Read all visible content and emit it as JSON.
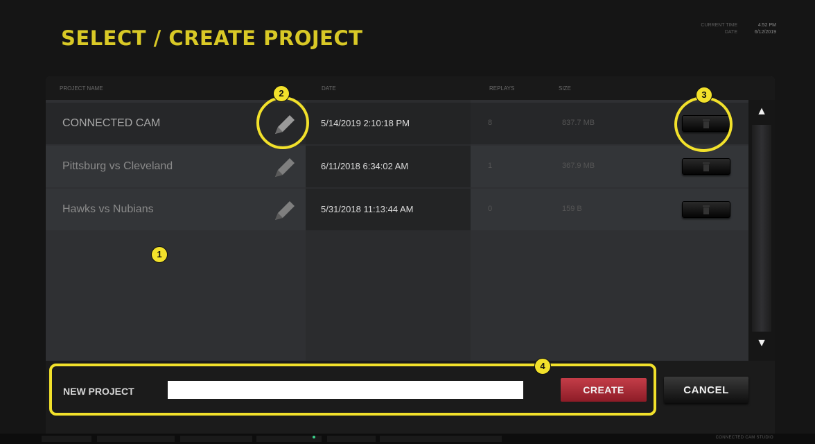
{
  "header": {
    "title": "SELECT / CREATE PROJECT",
    "clock": {
      "time_label": "CURRENT TIME",
      "date_label": "DATE",
      "time_value": "4:52 PM",
      "date_value": "6/12/2019"
    }
  },
  "table": {
    "columns": [
      "PROJECT NAME",
      "DATE",
      "REPLAYS",
      "SIZE"
    ],
    "rows": [
      {
        "name": "CONNECTED CAM",
        "date": "5/14/2019 2:10:18 PM",
        "replays": "8",
        "size": "837.7 MB"
      },
      {
        "name": "Pittsburg vs Cleveland",
        "date": "6/11/2018 6:34:02 AM",
        "replays": "1",
        "size": "367.9 MB"
      },
      {
        "name": "Hawks vs Nubians",
        "date": "5/31/2018 11:13:44 AM",
        "replays": "0",
        "size": "159 B"
      }
    ]
  },
  "new_project": {
    "label": "NEW PROJECT",
    "value": "",
    "create_label": "CREATE",
    "cancel_label": "CANCEL"
  },
  "status_bar": {
    "brand": "CONNECTED CAM STUDIO"
  },
  "annotations": {
    "badges": [
      "1",
      "2",
      "3",
      "4"
    ],
    "color": "#f2e12b"
  },
  "colors": {
    "title": "#d9c926",
    "create_button": "#b32f3a"
  },
  "icons": {
    "edit": "pencil-icon",
    "delete": "trash-icon",
    "scroll_up": "triangle-up-icon",
    "scroll_down": "triangle-down-icon"
  }
}
